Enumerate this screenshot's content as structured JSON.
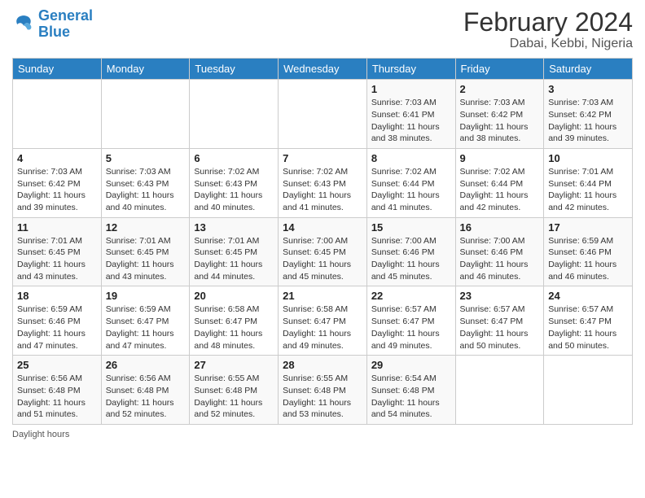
{
  "header": {
    "logo_line1": "General",
    "logo_line2": "Blue",
    "month_title": "February 2024",
    "location": "Dabai, Kebbi, Nigeria"
  },
  "days_of_week": [
    "Sunday",
    "Monday",
    "Tuesday",
    "Wednesday",
    "Thursday",
    "Friday",
    "Saturday"
  ],
  "footer": {
    "daylight_label": "Daylight hours"
  },
  "weeks": [
    [
      {
        "day": "",
        "info": ""
      },
      {
        "day": "",
        "info": ""
      },
      {
        "day": "",
        "info": ""
      },
      {
        "day": "",
        "info": ""
      },
      {
        "day": "1",
        "info": "Sunrise: 7:03 AM\nSunset: 6:41 PM\nDaylight: 11 hours and 38 minutes."
      },
      {
        "day": "2",
        "info": "Sunrise: 7:03 AM\nSunset: 6:42 PM\nDaylight: 11 hours and 38 minutes."
      },
      {
        "day": "3",
        "info": "Sunrise: 7:03 AM\nSunset: 6:42 PM\nDaylight: 11 hours and 39 minutes."
      }
    ],
    [
      {
        "day": "4",
        "info": "Sunrise: 7:03 AM\nSunset: 6:42 PM\nDaylight: 11 hours and 39 minutes."
      },
      {
        "day": "5",
        "info": "Sunrise: 7:03 AM\nSunset: 6:43 PM\nDaylight: 11 hours and 40 minutes."
      },
      {
        "day": "6",
        "info": "Sunrise: 7:02 AM\nSunset: 6:43 PM\nDaylight: 11 hours and 40 minutes."
      },
      {
        "day": "7",
        "info": "Sunrise: 7:02 AM\nSunset: 6:43 PM\nDaylight: 11 hours and 41 minutes."
      },
      {
        "day": "8",
        "info": "Sunrise: 7:02 AM\nSunset: 6:44 PM\nDaylight: 11 hours and 41 minutes."
      },
      {
        "day": "9",
        "info": "Sunrise: 7:02 AM\nSunset: 6:44 PM\nDaylight: 11 hours and 42 minutes."
      },
      {
        "day": "10",
        "info": "Sunrise: 7:01 AM\nSunset: 6:44 PM\nDaylight: 11 hours and 42 minutes."
      }
    ],
    [
      {
        "day": "11",
        "info": "Sunrise: 7:01 AM\nSunset: 6:45 PM\nDaylight: 11 hours and 43 minutes."
      },
      {
        "day": "12",
        "info": "Sunrise: 7:01 AM\nSunset: 6:45 PM\nDaylight: 11 hours and 43 minutes."
      },
      {
        "day": "13",
        "info": "Sunrise: 7:01 AM\nSunset: 6:45 PM\nDaylight: 11 hours and 44 minutes."
      },
      {
        "day": "14",
        "info": "Sunrise: 7:00 AM\nSunset: 6:45 PM\nDaylight: 11 hours and 45 minutes."
      },
      {
        "day": "15",
        "info": "Sunrise: 7:00 AM\nSunset: 6:46 PM\nDaylight: 11 hours and 45 minutes."
      },
      {
        "day": "16",
        "info": "Sunrise: 7:00 AM\nSunset: 6:46 PM\nDaylight: 11 hours and 46 minutes."
      },
      {
        "day": "17",
        "info": "Sunrise: 6:59 AM\nSunset: 6:46 PM\nDaylight: 11 hours and 46 minutes."
      }
    ],
    [
      {
        "day": "18",
        "info": "Sunrise: 6:59 AM\nSunset: 6:46 PM\nDaylight: 11 hours and 47 minutes."
      },
      {
        "day": "19",
        "info": "Sunrise: 6:59 AM\nSunset: 6:47 PM\nDaylight: 11 hours and 47 minutes."
      },
      {
        "day": "20",
        "info": "Sunrise: 6:58 AM\nSunset: 6:47 PM\nDaylight: 11 hours and 48 minutes."
      },
      {
        "day": "21",
        "info": "Sunrise: 6:58 AM\nSunset: 6:47 PM\nDaylight: 11 hours and 49 minutes."
      },
      {
        "day": "22",
        "info": "Sunrise: 6:57 AM\nSunset: 6:47 PM\nDaylight: 11 hours and 49 minutes."
      },
      {
        "day": "23",
        "info": "Sunrise: 6:57 AM\nSunset: 6:47 PM\nDaylight: 11 hours and 50 minutes."
      },
      {
        "day": "24",
        "info": "Sunrise: 6:57 AM\nSunset: 6:47 PM\nDaylight: 11 hours and 50 minutes."
      }
    ],
    [
      {
        "day": "25",
        "info": "Sunrise: 6:56 AM\nSunset: 6:48 PM\nDaylight: 11 hours and 51 minutes."
      },
      {
        "day": "26",
        "info": "Sunrise: 6:56 AM\nSunset: 6:48 PM\nDaylight: 11 hours and 52 minutes."
      },
      {
        "day": "27",
        "info": "Sunrise: 6:55 AM\nSunset: 6:48 PM\nDaylight: 11 hours and 52 minutes."
      },
      {
        "day": "28",
        "info": "Sunrise: 6:55 AM\nSunset: 6:48 PM\nDaylight: 11 hours and 53 minutes."
      },
      {
        "day": "29",
        "info": "Sunrise: 6:54 AM\nSunset: 6:48 PM\nDaylight: 11 hours and 54 minutes."
      },
      {
        "day": "",
        "info": ""
      },
      {
        "day": "",
        "info": ""
      }
    ]
  ]
}
